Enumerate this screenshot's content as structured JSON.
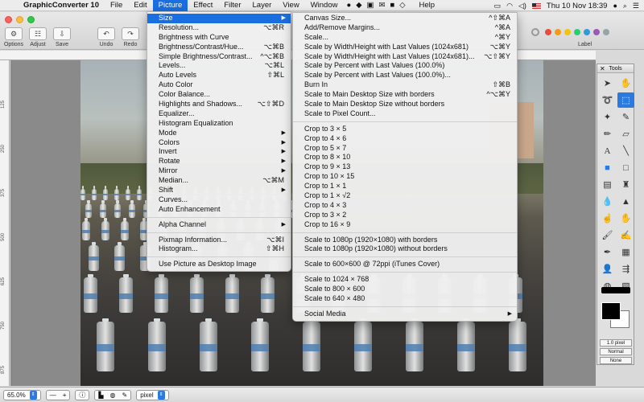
{
  "menubar": {
    "app_name": "GraphicConverter 10",
    "items": [
      "File",
      "Edit",
      "Picture",
      "Effect",
      "Filter",
      "Layer",
      "View",
      "Window",
      "Help"
    ],
    "active_item": "Picture",
    "clock": "Thu 10 Nov  18:39"
  },
  "toolbar": {
    "buttons": [
      {
        "name": "options",
        "label": "Options"
      },
      {
        "name": "adjust",
        "label": "Adjust"
      },
      {
        "name": "save",
        "label": "Save"
      },
      {
        "name": "undo",
        "label": "Undo"
      },
      {
        "name": "redo",
        "label": "Redo"
      }
    ],
    "label_text": "Label",
    "label_colors": [
      "#e74c3c",
      "#f39c12",
      "#f1c40f",
      "#2ecc71",
      "#3498db",
      "#9b59b6",
      "#95a5a6"
    ]
  },
  "ruler_left_ticks": [
    "125",
    "250",
    "375",
    "500",
    "625",
    "750",
    "875"
  ],
  "picture_menu": {
    "groups": [
      [
        {
          "label": "Size",
          "submenu": true,
          "highlighted": true
        },
        {
          "label": "Resolution...",
          "shortcut": "⌥⌘R"
        },
        {
          "label": "Brightness with Curve"
        },
        {
          "label": "Brightness/Contrast/Hue...",
          "shortcut": "⌥⌘B"
        },
        {
          "label": "Simple Brightness/Contrast...",
          "shortcut": "^⌥⌘B"
        },
        {
          "label": "Levels...",
          "shortcut": "⌥⌘L"
        },
        {
          "label": "Auto Levels",
          "shortcut": "⇧⌘L"
        },
        {
          "label": "Auto Color"
        },
        {
          "label": "Color Balance..."
        },
        {
          "label": "Highlights and Shadows...",
          "shortcut": "⌥⇧⌘D"
        },
        {
          "label": "Equalizer..."
        },
        {
          "label": "Histogram Equalization"
        },
        {
          "label": "Mode",
          "submenu": true
        },
        {
          "label": "Colors",
          "submenu": true
        },
        {
          "label": "Invert",
          "submenu": true
        },
        {
          "label": "Rotate",
          "submenu": true
        },
        {
          "label": "Mirror",
          "submenu": true
        },
        {
          "label": "Median...",
          "shortcut": "⌥⌘M"
        },
        {
          "label": "Shift",
          "submenu": true
        },
        {
          "label": "Curves..."
        },
        {
          "label": "Auto Enhancement"
        }
      ],
      [
        {
          "label": "Alpha Channel",
          "submenu": true
        }
      ],
      [
        {
          "label": "Pixmap Information...",
          "shortcut": "⌥⌘I"
        },
        {
          "label": "Histogram...",
          "shortcut": "⇧⌘H"
        }
      ],
      [
        {
          "label": "Use Picture as Desktop Image"
        }
      ]
    ]
  },
  "size_menu": {
    "groups": [
      [
        {
          "label": "Canvas Size...",
          "shortcut": "^⇧⌘A"
        },
        {
          "label": "Add/Remove Margins...",
          "shortcut": "^⌘A"
        },
        {
          "label": "Scale...",
          "shortcut": "^⌘Y"
        },
        {
          "label": "Scale by Width/Height with Last Values (1024x681)",
          "shortcut": "⌥⌘Y"
        },
        {
          "label": "Scale by Width/Height with Last Values (1024x681)...",
          "shortcut": "⌥⇧⌘Y"
        },
        {
          "label": "Scale by Percent with Last Values (100.0%)"
        },
        {
          "label": "Scale by Percent with Last Values (100.0%)..."
        },
        {
          "label": "Burn In",
          "shortcut": "⇧⌘B"
        },
        {
          "label": "Scale to Main Desktop Size with borders",
          "shortcut": "^⌥⌘Y"
        },
        {
          "label": "Scale to Main Desktop Size without borders"
        },
        {
          "label": "Scale to Pixel Count..."
        }
      ],
      [
        {
          "label": "Crop to 3 × 5"
        },
        {
          "label": "Crop to 4 × 6"
        },
        {
          "label": "Crop to 5 × 7"
        },
        {
          "label": "Crop to 8 × 10"
        },
        {
          "label": "Crop to 9 × 13"
        },
        {
          "label": "Crop to 10 × 15"
        },
        {
          "label": "Crop to 1 × 1"
        },
        {
          "label": "Crop to 1 × √2"
        },
        {
          "label": "Crop to 4 × 3"
        },
        {
          "label": "Crop to 3 × 2"
        },
        {
          "label": "Crop to 16 × 9"
        }
      ],
      [
        {
          "label": "Scale to 1080p (1920×1080) with borders"
        },
        {
          "label": "Scale to 1080p (1920×1080) without borders"
        }
      ],
      [
        {
          "label": "Scale to 600×600 @ 72ppi (iTunes Cover)"
        }
      ],
      [
        {
          "label": "Scale to 1024 × 768"
        },
        {
          "label": "Scale to 800 × 600"
        },
        {
          "label": "Scale to 640 × 480"
        }
      ],
      [
        {
          "label": "Social Media",
          "submenu": true
        }
      ]
    ]
  },
  "tools_panel": {
    "title": "Tools",
    "brush_size": "1.0 pixel",
    "blend_mode": "Normal",
    "option": "None"
  },
  "statusbar": {
    "zoom": "65.0%",
    "unit": "pixel"
  }
}
